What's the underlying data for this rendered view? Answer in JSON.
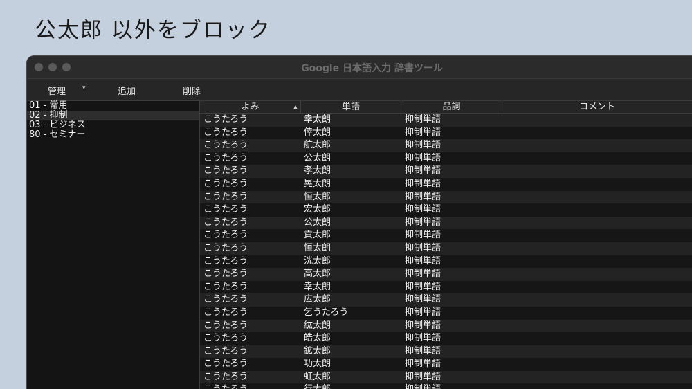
{
  "slide": {
    "title": "公太郎 以外をブロック"
  },
  "window": {
    "title": "Google 日本語入力 辞書ツール"
  },
  "toolbar": {
    "manage": "管理",
    "add": "追加",
    "delete": "削除"
  },
  "dictionaries": [
    "01 - 常用",
    "02 - 抑制",
    "03 - ビジネス",
    "80 - セミナー"
  ],
  "selected_dictionary": "02 - 抑制",
  "table": {
    "columns": [
      "よみ",
      "単語",
      "品詞",
      "コメント"
    ],
    "sort_column": "よみ",
    "rows": [
      [
        "こうたろう",
        "幸太朗",
        "抑制単語",
        ""
      ],
      [
        "こうたろう",
        "倖太朗",
        "抑制単語",
        ""
      ],
      [
        "こうたろう",
        "航太郎",
        "抑制単語",
        ""
      ],
      [
        "こうたろう",
        "公太朗",
        "抑制単語",
        ""
      ],
      [
        "こうたろう",
        "孝太朗",
        "抑制単語",
        ""
      ],
      [
        "こうたろう",
        "晃太朗",
        "抑制単語",
        ""
      ],
      [
        "こうたろう",
        "恒太郎",
        "抑制単語",
        ""
      ],
      [
        "こうたろう",
        "宏太郎",
        "抑制単語",
        ""
      ],
      [
        "こうたろう",
        "公太朗",
        "抑制単語",
        ""
      ],
      [
        "こうたろう",
        "貢太郎",
        "抑制単語",
        ""
      ],
      [
        "こうたろう",
        "恒太朗",
        "抑制単語",
        ""
      ],
      [
        "こうたろう",
        "洸太郎",
        "抑制単語",
        ""
      ],
      [
        "こうたろう",
        "高太郎",
        "抑制単語",
        ""
      ],
      [
        "こうたろう",
        "幸太朗",
        "抑制単語",
        ""
      ],
      [
        "こうたろう",
        "広太郎",
        "抑制単語",
        ""
      ],
      [
        "こうたろう",
        "乞うたろう",
        "抑制単語",
        ""
      ],
      [
        "こうたろう",
        "紘太朗",
        "抑制単語",
        ""
      ],
      [
        "こうたろう",
        "皓太郎",
        "抑制単語",
        ""
      ],
      [
        "こうたろう",
        "鉱太郎",
        "抑制単語",
        ""
      ],
      [
        "こうたろう",
        "功太朗",
        "抑制単語",
        ""
      ],
      [
        "こうたろう",
        "虹太郎",
        "抑制単語",
        ""
      ],
      [
        "こうたろう",
        "行太郎",
        "抑制単語",
        ""
      ]
    ]
  }
}
